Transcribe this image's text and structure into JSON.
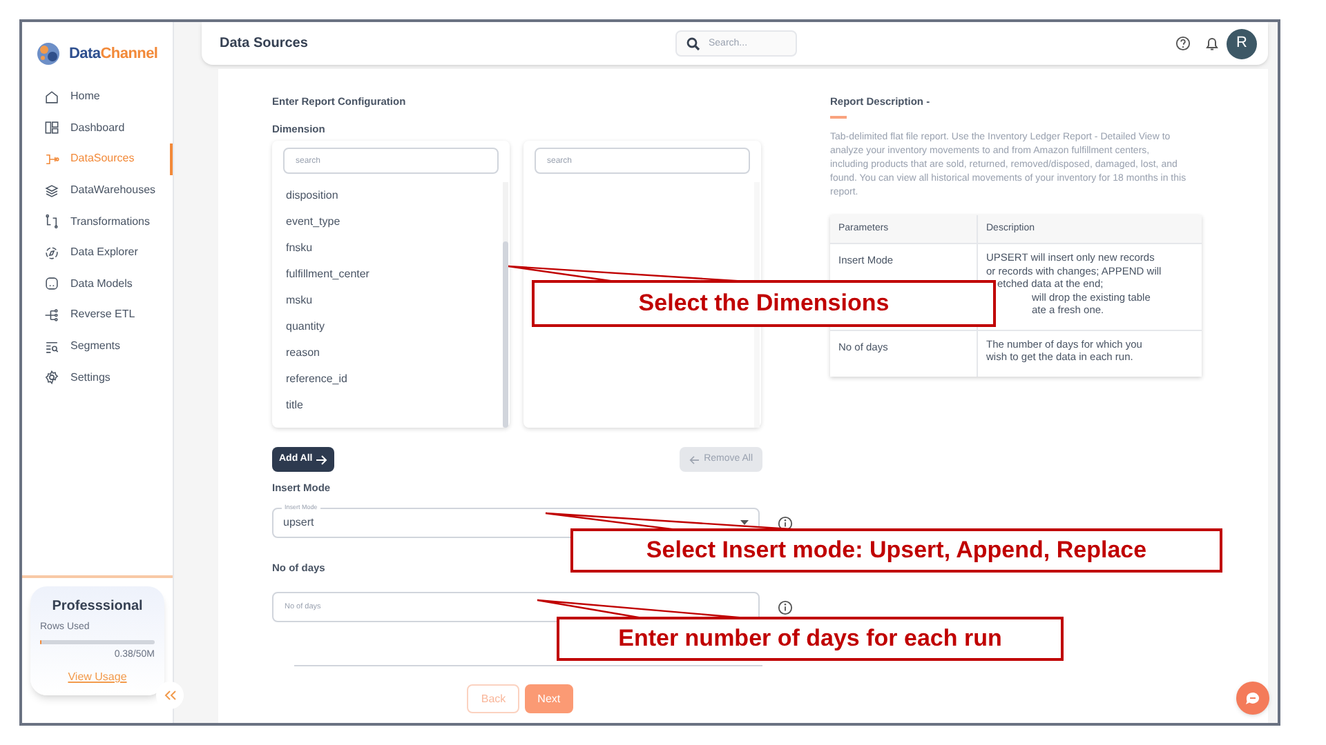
{
  "sidebar": {
    "logo": {
      "part1": "Data",
      "part2": "Channel"
    },
    "items": [
      {
        "label": "Home",
        "selected": false
      },
      {
        "label": "Dashboard",
        "selected": false
      },
      {
        "label": "DataSources",
        "selected": true
      },
      {
        "label": "DataWarehouses",
        "selected": false
      },
      {
        "label": "Transformations",
        "selected": false
      },
      {
        "label": "Data Explorer",
        "selected": false
      },
      {
        "label": "Data Models",
        "selected": false
      },
      {
        "label": "Reverse ETL",
        "selected": false
      },
      {
        "label": "Segments",
        "selected": false
      },
      {
        "label": "Settings",
        "selected": false
      }
    ],
    "plan": {
      "name": "Professsional",
      "label": "Rows Used",
      "level": 0.01,
      "usage": "0.38/50M",
      "link": "View Usage"
    }
  },
  "header": {
    "title": "Data Sources",
    "search": {
      "placeholder": "Search..."
    },
    "avatar": "R"
  },
  "form": {
    "heading": "Enter Report Configuration",
    "dimension_label": "Dimension",
    "available": {
      "placeholder": "search",
      "items": [
        "disposition",
        "event_type",
        "fnsku",
        "fulfillment_center",
        "msku",
        "quantity",
        "reason",
        "reference_id",
        "title"
      ]
    },
    "chosen": {
      "placeholder": "search"
    },
    "add_all": "Add All",
    "remove_all": {
      "label": "Remove All",
      "disabled": true
    },
    "insert_mode": {
      "label": "Insert Mode",
      "field_label": "Insert Mode",
      "value": "upsert"
    },
    "days": {
      "label": "No of days",
      "placeholder": "No of days"
    },
    "buttons": [
      {
        "label": "Back",
        "kind": "outline"
      },
      {
        "label": "Next",
        "kind": "filled"
      }
    ]
  },
  "description": {
    "title": "Report Description -",
    "text": "Tab-delimited flat file report. Use the Inventory Ledger Report - Detailed View to analyze your inventory movements to and from Amazon fulfillment centers, including products that are sold, returned, removed/disposed, damaged, lost, and found. You can view all historical movements of your inventory for 18 months in this report.",
    "table": {
      "columns": [
        "Parameters",
        "Description"
      ],
      "rows": [
        {
          "parameter": "Insert Mode",
          "lines": [
            "UPSERT will insert only new records",
            "or records with changes; APPEND will",
            "etched data at the end;",
            "will drop the existing table",
            "ate a fresh one."
          ]
        },
        {
          "parameter": "No of days",
          "lines": [
            "The number of days for which you",
            "wish to get the data in each run."
          ]
        }
      ]
    }
  },
  "callouts": [
    {
      "text": "Select the Dimensions"
    },
    {
      "text": "Select Insert mode: Upsert, Append, Replace"
    },
    {
      "text": "Enter number of days for each run"
    }
  ]
}
